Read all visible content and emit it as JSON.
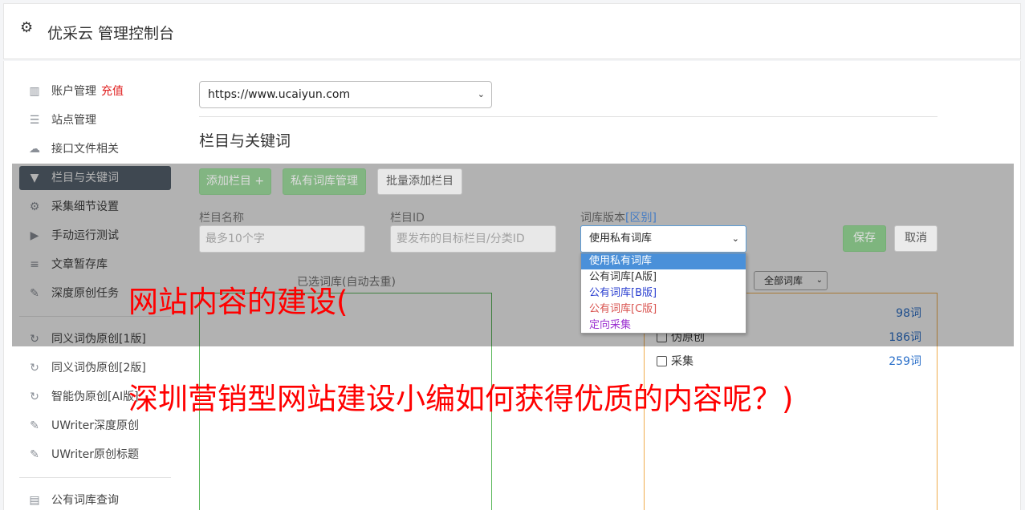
{
  "header": {
    "title": "优采云 管理控制台",
    "icon": "gear-icon"
  },
  "sidebar": {
    "items": [
      {
        "label": "账户管理",
        "extra": "充值",
        "icon": "bar-chart-icon"
      },
      {
        "label": "站点管理",
        "icon": "server-icon"
      },
      {
        "label": "接口文件相关",
        "icon": "cloud-upload-icon"
      },
      {
        "label": "栏目与关键词",
        "icon": "filter-icon",
        "active": true
      },
      {
        "label": "采集细节设置",
        "icon": "cogs-icon"
      },
      {
        "label": "手动运行测试",
        "icon": "play-circle-icon"
      },
      {
        "label": "文章暂存库",
        "icon": "database-icon"
      },
      {
        "label": "深度原创任务",
        "icon": "edit-icon"
      },
      {
        "label": "同义词伪原创[1版]",
        "icon": "refresh-icon"
      },
      {
        "label": "同义词伪原创[2版]",
        "icon": "refresh-icon"
      },
      {
        "label": "智能伪原创[AI版]",
        "icon": "refresh-icon"
      },
      {
        "label": "UWriter深度原创",
        "icon": "edit-icon"
      },
      {
        "label": "UWriter原创标题",
        "icon": "edit-icon"
      },
      {
        "label": "公有词库查询",
        "icon": "book-icon"
      }
    ]
  },
  "main": {
    "site_select": "https://www.ucaiyun.com",
    "section_title": "栏目与关键词",
    "buttons": {
      "add_column": "添加栏目 +",
      "private_lib": "私有词库管理",
      "batch_add": "批量添加栏目",
      "save": "保存",
      "cancel": "取消"
    },
    "fields": {
      "column_name": {
        "label": "栏目名称",
        "placeholder": "最多10个字"
      },
      "column_id": {
        "label": "栏目ID",
        "placeholder": "要发布的目标栏目/分类ID"
      },
      "lib_version": {
        "label": "词库版本",
        "label_link": "[区别]",
        "value": "使用私有词库"
      }
    },
    "dropdown_options": [
      {
        "label": "使用私有词库",
        "color": "#ffffff",
        "selected": true
      },
      {
        "label": "公有词库[A版]",
        "color": "#333333"
      },
      {
        "label": "公有词库[B版]",
        "color": "#2a3fd0"
      },
      {
        "label": "公有词库[C版]",
        "color": "#d9534f"
      },
      {
        "label": "定向采集",
        "color": "#9b30d0"
      }
    ],
    "selected_caption": "已选词库(自动去重)",
    "lib_filter": "全部词库",
    "libraries": [
      {
        "name": "",
        "count": "98词"
      },
      {
        "name": "伪原创",
        "count": "186词"
      },
      {
        "name": "采集",
        "count": "259词"
      }
    ]
  },
  "overlay": {
    "line1": "网站内容的建设(",
    "line2": "深圳营销型网站建设小编如何获得优质的内容呢？)"
  },
  "colors": {
    "accent_green": "#5cb85c",
    "active_nav": "#5b6774",
    "overlay_red": "#ff0000"
  }
}
